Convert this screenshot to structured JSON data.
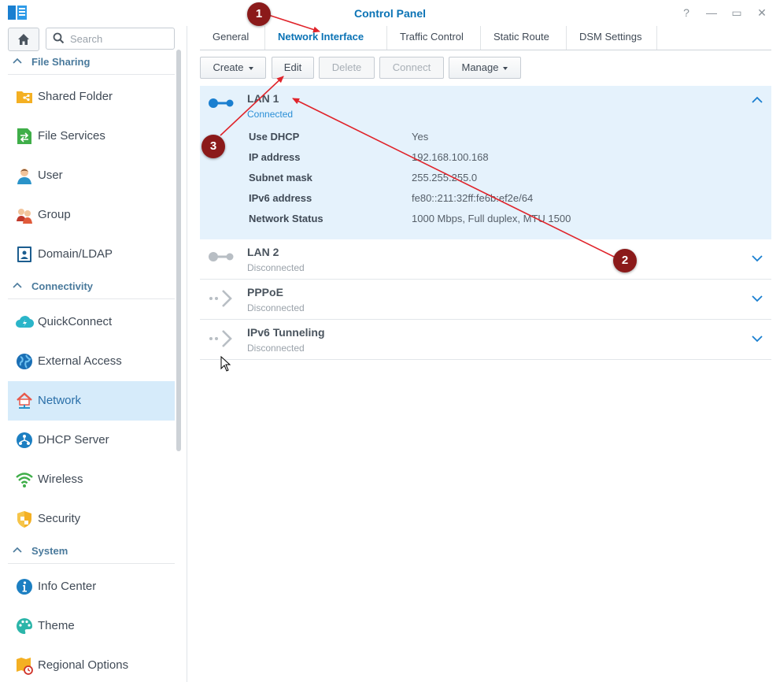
{
  "window": {
    "title": "Control Panel",
    "buttons": {
      "help": "?",
      "minimize": "—",
      "maximize": "▭",
      "close": "✕"
    }
  },
  "search": {
    "placeholder": "Search"
  },
  "sidebar": {
    "sections": [
      {
        "label": "File Sharing",
        "items": [
          {
            "label": "Shared Folder",
            "icon": "shared-folder-icon"
          },
          {
            "label": "File Services",
            "icon": "file-services-icon"
          },
          {
            "label": "User",
            "icon": "user-icon"
          },
          {
            "label": "Group",
            "icon": "group-icon"
          },
          {
            "label": "Domain/LDAP",
            "icon": "domain-ldap-icon"
          }
        ]
      },
      {
        "label": "Connectivity",
        "items": [
          {
            "label": "QuickConnect",
            "icon": "quickconnect-icon"
          },
          {
            "label": "External Access",
            "icon": "external-access-icon"
          },
          {
            "label": "Network",
            "icon": "network-icon",
            "active": true
          },
          {
            "label": "DHCP Server",
            "icon": "dhcp-server-icon"
          },
          {
            "label": "Wireless",
            "icon": "wireless-icon"
          },
          {
            "label": "Security",
            "icon": "security-icon"
          }
        ]
      },
      {
        "label": "System",
        "items": [
          {
            "label": "Info Center",
            "icon": "info-center-icon"
          },
          {
            "label": "Theme",
            "icon": "theme-icon"
          },
          {
            "label": "Regional Options",
            "icon": "regional-options-icon"
          }
        ]
      }
    ]
  },
  "tabs": [
    {
      "label": "General"
    },
    {
      "label": "Network Interface",
      "active": true
    },
    {
      "label": "Traffic Control"
    },
    {
      "label": "Static Route"
    },
    {
      "label": "DSM Settings"
    }
  ],
  "toolbar": {
    "create": "Create",
    "edit": "Edit",
    "delete": "Delete",
    "connect": "Connect",
    "manage": "Manage"
  },
  "interfaces": [
    {
      "name": "LAN 1",
      "status": "Connected",
      "expanded": true,
      "details": [
        {
          "key": "Use DHCP",
          "value": "Yes"
        },
        {
          "key": "IP address",
          "value": "192.168.100.168"
        },
        {
          "key": "Subnet mask",
          "value": "255.255.255.0"
        },
        {
          "key": "IPv6 address",
          "value": "fe80::211:32ff:fe6b:ef2e/64"
        },
        {
          "key": "Network Status",
          "value": "1000 Mbps, Full duplex, MTU 1500"
        }
      ]
    },
    {
      "name": "LAN 2",
      "status": "Disconnected"
    },
    {
      "name": "PPPoE",
      "status": "Disconnected"
    },
    {
      "name": "IPv6 Tunneling",
      "status": "Disconnected"
    }
  ],
  "annotations": {
    "badge1": "1",
    "badge2": "2",
    "badge3": "3"
  },
  "colors": {
    "accent": "#0b73b5",
    "active_bg": "#d6ebfa",
    "expanded_bg": "#e5f2fc",
    "annotation": "#8b1a1a",
    "arrow": "#e0242b"
  }
}
